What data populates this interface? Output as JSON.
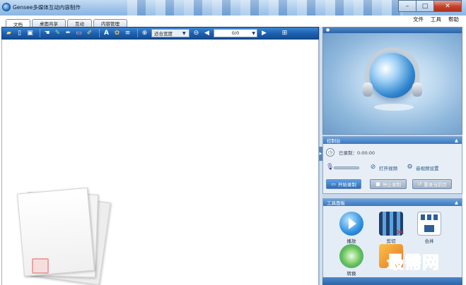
{
  "window": {
    "title": "Gensee多媒体互动内容制作",
    "controls": {
      "minimize": "–",
      "maximize": "□",
      "close": "✕"
    }
  },
  "menu": [
    "文件",
    "工具",
    "帮助"
  ],
  "tabs": [
    {
      "label": "文档",
      "active": true
    },
    {
      "label": "桌面共享",
      "active": false
    },
    {
      "label": "互动",
      "active": false
    },
    {
      "label": "内容管理",
      "active": false
    }
  ],
  "toolbar": {
    "icons": [
      "open-folder-icon",
      "new-document-icon",
      "save-icon",
      "pointer-hand-icon",
      "pencil-icon",
      "pen-icon",
      "eraser-icon",
      "highlighter-icon",
      "text-icon",
      "color-brush-icon",
      "line-width-icon",
      "zoom-in-icon",
      "zoom-out-icon",
      "prev-page-icon",
      "next-page-icon",
      "grid-icon"
    ],
    "zoom_label": "适合宽度",
    "page_value": "0/0",
    "colors": {
      "accent": "#1c5fae"
    }
  },
  "right_panel": {
    "control": {
      "title": "控制台",
      "recorded_label": "已录制：0:00:00",
      "open_video": "打开视频",
      "av_settings": "音视频设置",
      "start_record": "开始录制",
      "stop_record": "停止录制",
      "reset_record": "重录当前页"
    },
    "tools": {
      "title": "工具面板",
      "items": [
        "播放",
        "剪切",
        "合并",
        "转换"
      ]
    }
  },
  "watermark": "最需网"
}
